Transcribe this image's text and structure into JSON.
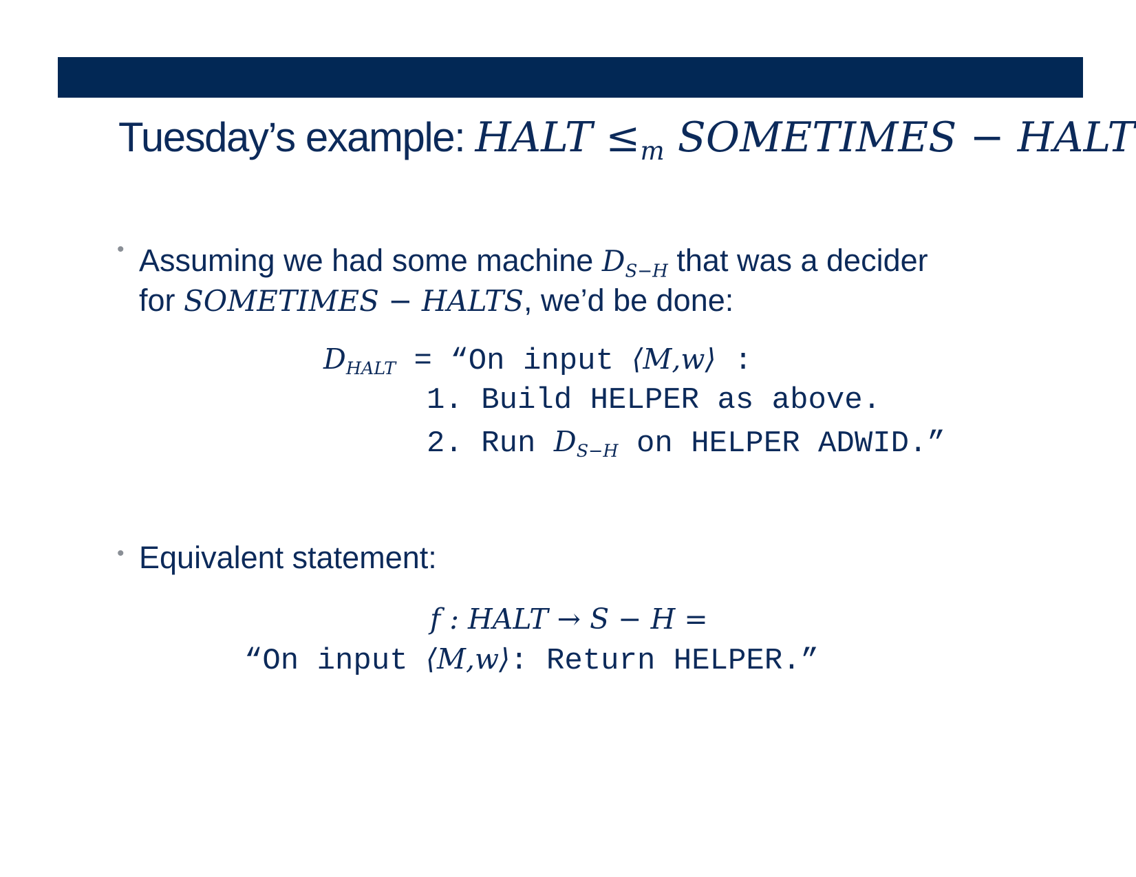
{
  "title": {
    "text": "Tuesday’s example:",
    "halt": "HALT",
    "leq": "≤",
    "m": "m",
    "sometimes_halts": "SOMETIMES − HALTS"
  },
  "bullets": [
    {
      "line1_a": "Assuming we had some machine",
      "D": "D",
      "D_sub": "S−H",
      "line1_b": "that was a decider",
      "line2_a": "for",
      "line2_math": "SOMETIMES − HALTS",
      "line2_b": ", we’d be done:"
    },
    {
      "text": "Equivalent statement:"
    }
  ],
  "decider": {
    "D": "D",
    "D_sub": "HALT",
    "eq": "=",
    "intro": "“On input",
    "input_math": "⟨M,w⟩",
    "colon": ":",
    "step1": "1. Build HELPER as above.",
    "step2_a": "2. Run",
    "step2_D": "D",
    "step2_sub": "S−H",
    "step2_b": "on HELPER ADWID.”"
  },
  "function": {
    "line1": "f : HALT → S − H =",
    "line2_a": "“On input",
    "line2_math": "⟨M,w⟩",
    "line2_b": ": Return HELPER.”"
  }
}
